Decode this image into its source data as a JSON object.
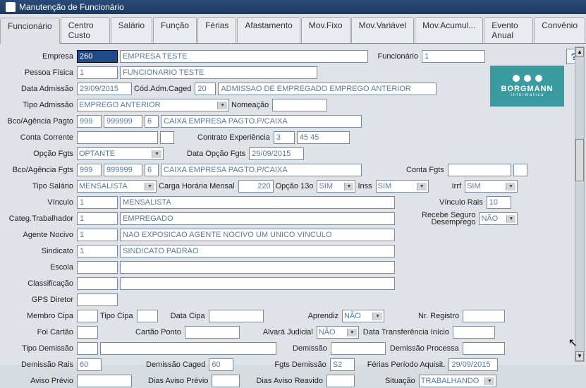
{
  "window": {
    "title": "Manutenção de Funcionário"
  },
  "tabs": [
    "Funcionário",
    "Centro Custo",
    "Salário",
    "Função",
    "Férias",
    "Afastamento",
    "Mov.Fixo",
    "Mov.Variável",
    "Mov.Acumul...",
    "Evento Anual",
    "Convênio"
  ],
  "labels": {
    "empresa": "Empresa",
    "funcionario": "Funcionário",
    "pessoa_fisica": "Pessoa Física",
    "data_admissao": "Data Admissão",
    "cod_adm_caged": "Cód.Adm.Caged",
    "tipo_admissao": "Tipo Admissão",
    "nomeacao": "Nomeação",
    "bco_agencia_pagto": "Bco/Agência Pagto",
    "conta_corrente": "Conta Corrente",
    "contrato_experiencia": "Contrato Experiência",
    "opcao_fgts": "Opção Fgts",
    "data_opcao_fgts": "Data Opção Fgts",
    "bco_agencia_fgts": "Bco/Agência Fgts",
    "conta_fgts": "Conta Fgts",
    "tipo_salario": "Tipo Salário",
    "carga_horaria_mensal": "Carga Horária Mensal",
    "opcao_13o": "Opção 13o",
    "inss": "Inss",
    "irrf": "Irrf",
    "vinculo": "Vínculo",
    "vinculo_rais": "Vínculo Rais",
    "categ_trabalhador": "Categ.Trabalhador",
    "recebe_seguro_desemprego": "Recebe Seguro Desemprego",
    "agente_nocivo": "Agente Nocivo",
    "sindicato": "Sindicato",
    "escola": "Escola",
    "classificacao": "Classificação",
    "gps_diretor": "GPS Diretor",
    "membro_cipa": "Membro Cipa",
    "tipo_cipa": "Tipo Cipa",
    "data_cipa": "Data Cipa",
    "aprendiz": "Aprendiz",
    "nr_registro": "Nr. Registro",
    "foi_cartao": "Foi Cartão",
    "cartao_ponto": "Cartão Ponto",
    "alvara_judicial": "Alvará Judicial",
    "data_transferencia_inicio": "Data Transferência Início",
    "tipo_demissao": "Tipo Demissão",
    "demissao": "Demissão",
    "demissao_processa": "Demissão Processa",
    "demissao_rais": "Demissão Rais",
    "demissao_caged": "Demissão Caged",
    "fgts_demissao": "Fgts Demissão",
    "ferias_periodo_aquisit": "Férias Período Aquisit.",
    "aviso_previo": "Aviso Prévio",
    "dias_aviso_previo": "Dias Aviso Prévio",
    "dias_aviso_reavido": "Dias Aviso Reavido",
    "situacao": "Situação"
  },
  "values": {
    "empresa_cod": "260",
    "empresa_nome": "EMPRESA TESTE",
    "funcionario_cod": "1",
    "pessoa_fisica_cod": "1",
    "pessoa_fisica_nome": "FUNCIONARIO TESTE",
    "data_admissao": "29/09/2015",
    "cod_adm_caged": "20",
    "cod_adm_caged_desc": "ADMISSAO DE EMPREGADO EMPREGO ANTERIOR",
    "tipo_admissao": "EMPREGO ANTERIOR",
    "nomeacao": "",
    "bco_pagto": "999",
    "agencia_pagto": "999999",
    "bco_pagto_dig": "6",
    "bco_pagto_desc": "CAIXA EMPRESA PAGTO.P/CAIXA",
    "conta_corrente": "",
    "contrato_exp": "3",
    "contrato_exp_desc": "45 45",
    "opcao_fgts": "OPTANTE",
    "data_opcao_fgts": "29/09/2015",
    "bco_fgts": "999",
    "agencia_fgts": "999999",
    "bco_fgts_dig": "6",
    "bco_fgts_desc": "CAIXA EMPRESA PAGTO.P/CAIXA",
    "conta_fgts": "",
    "tipo_salario": "MENSALISTA",
    "carga_horaria": "220",
    "opcao_13o": "SIM",
    "inss": "SIM",
    "irrf": "SIM",
    "vinculo_cod": "1",
    "vinculo_desc": "MENSALISTA",
    "vinculo_rais": "10",
    "categ_trabalhador_cod": "1",
    "categ_trabalhador_desc": "EMPREGADO",
    "recebe_seguro": "NÃO",
    "agente_nocivo_cod": "1",
    "agente_nocivo_desc": "NAO EXPOSICAO AGENTE NOCIVO UM UNICO VINCULO",
    "sindicato_cod": "1",
    "sindicato_desc": "SINDICATO PADRAO",
    "escola": "",
    "classificacao": "",
    "gps_diretor": "",
    "membro_cipa": "",
    "tipo_cipa": "",
    "data_cipa": "",
    "aprendiz": "NÃO",
    "nr_registro": "",
    "foi_cartao": "",
    "cartao_ponto": "",
    "alvara_judicial": "NÃO",
    "data_transferencia": "",
    "tipo_demissao": "",
    "demissao": "",
    "demissao_processa": "",
    "demissao_rais": "60",
    "demissao_caged": "60",
    "fgts_demissao": "S2",
    "ferias_periodo": "29/09/2015",
    "aviso_previo": "",
    "dias_aviso_previo": "",
    "dias_aviso_reavido": "",
    "situacao": "TRABALHANDO"
  },
  "brand": {
    "name": "BORGMANN",
    "sub": "i n f o r m a t i c a"
  },
  "help": "?"
}
